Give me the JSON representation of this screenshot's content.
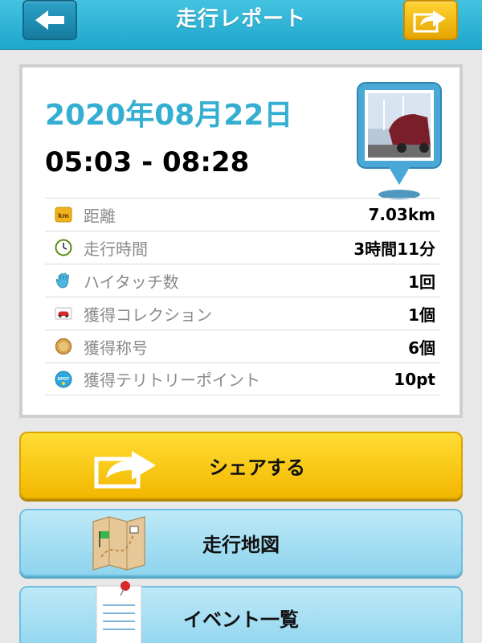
{
  "header": {
    "title": "走行レポート",
    "back_icon": "arrow-left-icon",
    "share_icon": "share-arrow-icon"
  },
  "report": {
    "date": "2020年08月22日",
    "time_range": "05:03 - 08:28",
    "photo_icon": "photo-pin-icon",
    "stats": [
      {
        "icon": "km-icon",
        "label": "距離",
        "value": "7.03km"
      },
      {
        "icon": "clock-icon",
        "label": "走行時間",
        "value": "3時間11分"
      },
      {
        "icon": "hand-icon",
        "label": "ハイタッチ数",
        "value": "1回"
      },
      {
        "icon": "car-card-icon",
        "label": "獲得コレクション",
        "value": "1個"
      },
      {
        "icon": "medal-icon",
        "label": "獲得称号",
        "value": "6個"
      },
      {
        "icon": "spot-icon",
        "label": "獲得テリトリーポイント",
        "value": "10pt"
      }
    ]
  },
  "buttons": {
    "share": "シェアする",
    "map": "走行地図",
    "events": "イベント一覧"
  },
  "colors": {
    "header": "#1ea6cc",
    "date_text": "#34aed1",
    "share_button": "#f3b700",
    "secondary_button": "#8fd4ee"
  }
}
